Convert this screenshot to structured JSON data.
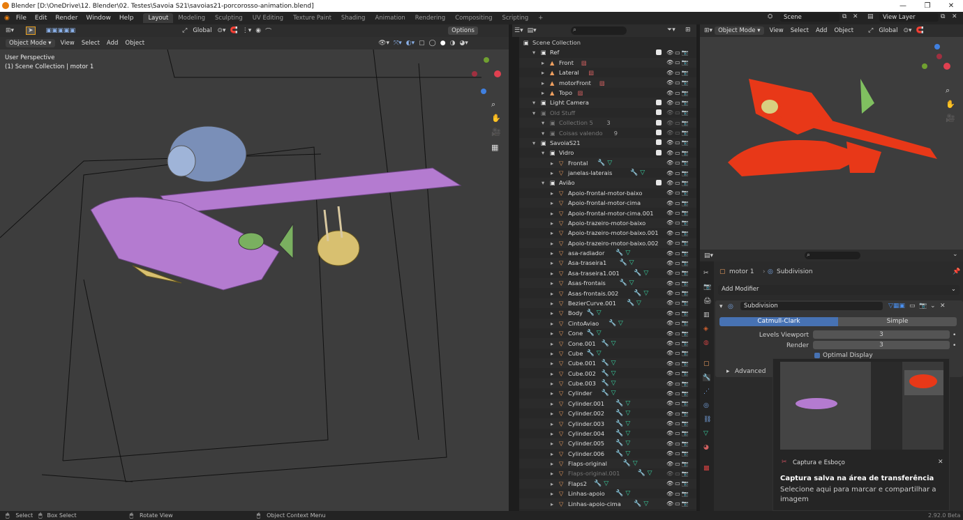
{
  "window": {
    "title": "Blender [D:\\OneDrive\\12. Blender\\02. Testes\\Savoia S21\\savoias21-porcorosso-animation.blend]",
    "minimize": "—",
    "maximize": "❐",
    "close": "✕"
  },
  "menus": [
    "File",
    "Edit",
    "Render",
    "Window",
    "Help"
  ],
  "workspaces": [
    "Layout",
    "Modeling",
    "Sculpting",
    "UV Editing",
    "Texture Paint",
    "Shading",
    "Animation",
    "Rendering",
    "Compositing",
    "Scripting"
  ],
  "active_workspace": "Layout",
  "scene": {
    "name": "Scene",
    "view_layer": "View Layer"
  },
  "toolbar": {
    "transform_space": "Global",
    "options": "Options"
  },
  "viewport": {
    "mode": "Object Mode",
    "menus": [
      "View",
      "Select",
      "Add",
      "Object"
    ],
    "perspective": "User Perspective",
    "collection_info": "(1) Scene Collection | motor 1"
  },
  "outliner": {
    "root": "Scene Collection",
    "rows": [
      {
        "name": "Ref",
        "depth": 1,
        "type": "collection",
        "check": true,
        "dim": false
      },
      {
        "name": "Front",
        "depth": 2,
        "type": "image",
        "check": false,
        "dim": false
      },
      {
        "name": "Lateral",
        "depth": 2,
        "type": "image",
        "check": false,
        "dim": false
      },
      {
        "name": "motorFront",
        "depth": 2,
        "type": "image",
        "check": false,
        "dim": false
      },
      {
        "name": "Topo",
        "depth": 2,
        "type": "image",
        "check": false,
        "dim": false
      },
      {
        "name": "Light Camera",
        "depth": 1,
        "type": "collection",
        "check": true,
        "dim": false
      },
      {
        "name": "Old Stuff",
        "depth": 1,
        "type": "collection",
        "check": true,
        "dim": true
      },
      {
        "name": "Collection 5",
        "depth": 2,
        "type": "collection",
        "check": true,
        "dim": true,
        "count": "3"
      },
      {
        "name": "Coisas valendo",
        "depth": 2,
        "type": "collection",
        "check": true,
        "dim": true,
        "count": "9"
      },
      {
        "name": "SavoiaS21",
        "depth": 1,
        "type": "collection",
        "check": true,
        "dim": false
      },
      {
        "name": "Vidro",
        "depth": 2,
        "type": "collection",
        "check": true,
        "dim": false
      },
      {
        "name": "Frontal",
        "depth": 3,
        "type": "mesh",
        "check": false,
        "dim": false
      },
      {
        "name": "janelas-laterais",
        "depth": 3,
        "type": "mesh",
        "check": false,
        "dim": false
      },
      {
        "name": "Avião",
        "depth": 2,
        "type": "collection",
        "check": true,
        "dim": false
      },
      {
        "name": "Apoio-frontal-motor-baixo",
        "depth": 3,
        "type": "mesh",
        "check": false,
        "dim": false
      },
      {
        "name": "Apoio-frontal-motor-cima",
        "depth": 3,
        "type": "mesh",
        "check": false,
        "dim": false
      },
      {
        "name": "Apoio-frontal-motor-cima.001",
        "depth": 3,
        "type": "mesh",
        "check": false,
        "dim": false
      },
      {
        "name": "Apoio-trazeiro-motor-baixo",
        "depth": 3,
        "type": "mesh",
        "check": false,
        "dim": false
      },
      {
        "name": "Apoio-trazeiro-motor-baixo.001",
        "depth": 3,
        "type": "mesh",
        "check": false,
        "dim": false
      },
      {
        "name": "Apoio-trazeiro-motor-baixo.002",
        "depth": 3,
        "type": "mesh",
        "check": false,
        "dim": false
      },
      {
        "name": "asa-radiador",
        "depth": 3,
        "type": "mesh",
        "check": false,
        "dim": false
      },
      {
        "name": "Asa-traseira1",
        "depth": 3,
        "type": "mesh",
        "check": false,
        "dim": false
      },
      {
        "name": "Asa-traseira1.001",
        "depth": 3,
        "type": "mesh",
        "check": false,
        "dim": false
      },
      {
        "name": "Asas-frontais",
        "depth": 3,
        "type": "mesh",
        "check": false,
        "dim": false
      },
      {
        "name": "Asas-frontais.002",
        "depth": 3,
        "type": "mesh",
        "check": false,
        "dim": false
      },
      {
        "name": "BezierCurve.001",
        "depth": 3,
        "type": "mesh",
        "check": false,
        "dim": false
      },
      {
        "name": "Body",
        "depth": 3,
        "type": "mesh",
        "check": false,
        "dim": false
      },
      {
        "name": "CintoAviao",
        "depth": 3,
        "type": "mesh",
        "check": false,
        "dim": false
      },
      {
        "name": "Cone",
        "depth": 3,
        "type": "mesh",
        "check": false,
        "dim": false
      },
      {
        "name": "Cone.001",
        "depth": 3,
        "type": "mesh",
        "check": false,
        "dim": false
      },
      {
        "name": "Cube",
        "depth": 3,
        "type": "mesh",
        "check": false,
        "dim": false
      },
      {
        "name": "Cube.001",
        "depth": 3,
        "type": "mesh",
        "check": false,
        "dim": false
      },
      {
        "name": "Cube.002",
        "depth": 3,
        "type": "mesh",
        "check": false,
        "dim": false
      },
      {
        "name": "Cube.003",
        "depth": 3,
        "type": "mesh",
        "check": false,
        "dim": false
      },
      {
        "name": "Cylinder",
        "depth": 3,
        "type": "mesh",
        "check": false,
        "dim": false
      },
      {
        "name": "Cylinder.001",
        "depth": 3,
        "type": "mesh",
        "check": false,
        "dim": false
      },
      {
        "name": "Cylinder.002",
        "depth": 3,
        "type": "mesh",
        "check": false,
        "dim": false
      },
      {
        "name": "Cylinder.003",
        "depth": 3,
        "type": "mesh",
        "check": false,
        "dim": false
      },
      {
        "name": "Cylinder.004",
        "depth": 3,
        "type": "mesh",
        "check": false,
        "dim": false
      },
      {
        "name": "Cylinder.005",
        "depth": 3,
        "type": "mesh",
        "check": false,
        "dim": false
      },
      {
        "name": "Cylinder.006",
        "depth": 3,
        "type": "mesh",
        "check": false,
        "dim": false
      },
      {
        "name": "Flaps-original",
        "depth": 3,
        "type": "mesh",
        "check": false,
        "dim": false
      },
      {
        "name": "Flaps-original.001",
        "depth": 3,
        "type": "mesh",
        "check": false,
        "dim": true
      },
      {
        "name": "Flaps2",
        "depth": 3,
        "type": "mesh",
        "check": false,
        "dim": false
      },
      {
        "name": "Linhas-apoio",
        "depth": 3,
        "type": "mesh",
        "check": false,
        "dim": false
      },
      {
        "name": "Linhas-apoio-cima",
        "depth": 3,
        "type": "mesh",
        "check": false,
        "dim": false
      }
    ]
  },
  "right_view": {
    "mode": "Object Mode",
    "menus": [
      "View",
      "Select",
      "Add",
      "Object"
    ],
    "transform_space": "Global"
  },
  "properties": {
    "object": "motor 1",
    "modifier_tab": "Subdivision",
    "add_modifier": "Add Modifier",
    "modifier_name": "Subdivision",
    "mode_a": "Catmull-Clark",
    "mode_b": "Simple",
    "levels_viewport_label": "Levels Viewport",
    "levels_viewport": "3",
    "render_label": "Render",
    "render": "3",
    "optimal_display": "Optimal Display",
    "advanced": "Advanced"
  },
  "toast": {
    "app": "Captura e Esboço",
    "title": "Captura salva na área de transferência",
    "body": "Selecione aqui para marcar e compartilhar a imagem"
  },
  "status": {
    "select": "Select",
    "box_select": "Box Select",
    "rotate_view": "Rotate View",
    "context_menu": "Object Context Menu",
    "version": "2.92.0 Beta"
  },
  "colors": {
    "accent": "#4772b3",
    "mesh": "#3ad0a0",
    "object": "#f0a060",
    "model_purple": "#b47bd0",
    "model_red": "#e83818"
  }
}
